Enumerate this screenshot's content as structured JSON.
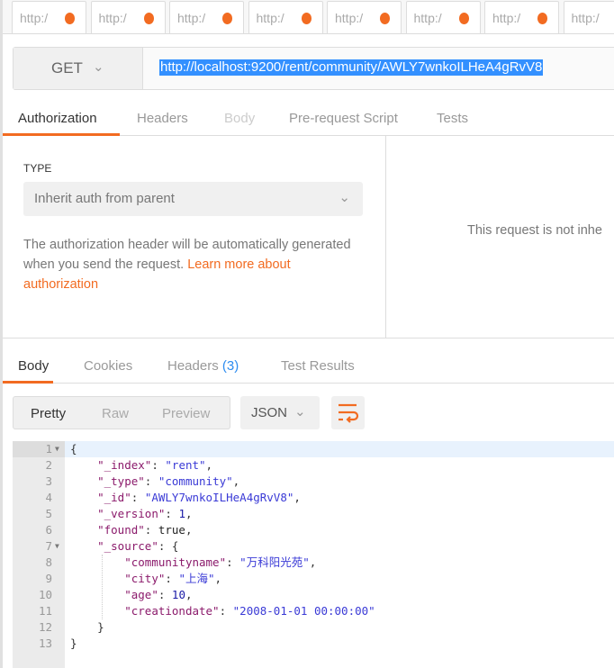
{
  "request_tabs": [
    {
      "label": "http:/"
    },
    {
      "label": "http:/"
    },
    {
      "label": "http:/"
    },
    {
      "label": "http:/"
    },
    {
      "label": "http:/"
    },
    {
      "label": "http:/"
    },
    {
      "label": "http:/"
    },
    {
      "label": "http:/"
    }
  ],
  "request": {
    "method": "GET",
    "url": "http://localhost:9200/rent/community/AWLY7wnkoILHeA4gRvV8"
  },
  "request_subtabs": {
    "authorization": "Authorization",
    "headers": "Headers",
    "body": "Body",
    "prerequest": "Pre-request Script",
    "tests": "Tests"
  },
  "auth": {
    "type_label": "TYPE",
    "type_value": "Inherit auth from parent",
    "description": "The authorization header will be automatically generated when you send the request. ",
    "learn_more": "Learn more about authorization",
    "right_message": "This request is not inhe"
  },
  "response_tabs": {
    "body": "Body",
    "cookies": "Cookies",
    "headers": "Headers",
    "headers_count": "(3)",
    "test_results": "Test Results"
  },
  "view_modes": {
    "pretty": "Pretty",
    "raw": "Raw",
    "preview": "Preview"
  },
  "format": "JSON",
  "icons": {
    "dropdown": "chevron-down-icon",
    "wrap": "wrap-lines-icon",
    "unsaved": "unsaved-dot-icon"
  },
  "colors": {
    "accent": "#f26b21",
    "selection": "#3390ff",
    "count": "#2d8cf0"
  },
  "response_lines": [
    {
      "n": "1",
      "fold": true,
      "t": [
        [
          "p",
          "{"
        ]
      ]
    },
    {
      "n": "2",
      "t": [
        [
          "p",
          "    "
        ],
        [
          "k",
          "\"_index\""
        ],
        [
          "p",
          ": "
        ],
        [
          "s",
          "\"rent\""
        ],
        [
          "p",
          ","
        ]
      ]
    },
    {
      "n": "3",
      "t": [
        [
          "p",
          "    "
        ],
        [
          "k",
          "\"_type\""
        ],
        [
          "p",
          ": "
        ],
        [
          "s",
          "\"community\""
        ],
        [
          "p",
          ","
        ]
      ]
    },
    {
      "n": "4",
      "t": [
        [
          "p",
          "    "
        ],
        [
          "k",
          "\"_id\""
        ],
        [
          "p",
          ": "
        ],
        [
          "s",
          "\"AWLY7wnkoILHeA4gRvV8\""
        ],
        [
          "p",
          ","
        ]
      ]
    },
    {
      "n": "5",
      "t": [
        [
          "p",
          "    "
        ],
        [
          "k",
          "\"_version\""
        ],
        [
          "p",
          ": "
        ],
        [
          "n",
          "1"
        ],
        [
          "p",
          ","
        ]
      ]
    },
    {
      "n": "6",
      "t": [
        [
          "p",
          "    "
        ],
        [
          "k",
          "\"found\""
        ],
        [
          "p",
          ": "
        ],
        [
          "b",
          "true"
        ],
        [
          "p",
          ","
        ]
      ]
    },
    {
      "n": "7",
      "fold": true,
      "t": [
        [
          "p",
          "    "
        ],
        [
          "k",
          "\"_source\""
        ],
        [
          "p",
          ": {"
        ]
      ]
    },
    {
      "n": "8",
      "t": [
        [
          "p",
          "        "
        ],
        [
          "k",
          "\"communityname\""
        ],
        [
          "p",
          ": "
        ],
        [
          "s",
          "\"万科阳光苑\""
        ],
        [
          "p",
          ","
        ]
      ]
    },
    {
      "n": "9",
      "t": [
        [
          "p",
          "        "
        ],
        [
          "k",
          "\"city\""
        ],
        [
          "p",
          ": "
        ],
        [
          "s",
          "\"上海\""
        ],
        [
          "p",
          ","
        ]
      ]
    },
    {
      "n": "10",
      "t": [
        [
          "p",
          "        "
        ],
        [
          "k",
          "\"age\""
        ],
        [
          "p",
          ": "
        ],
        [
          "n",
          "10"
        ],
        [
          "p",
          ","
        ]
      ]
    },
    {
      "n": "11",
      "t": [
        [
          "p",
          "        "
        ],
        [
          "k",
          "\"creationdate\""
        ],
        [
          "p",
          ": "
        ],
        [
          "s",
          "\"2008-01-01 00:00:00\""
        ]
      ]
    },
    {
      "n": "12",
      "t": [
        [
          "p",
          "    }"
        ]
      ]
    },
    {
      "n": "13",
      "t": [
        [
          "p",
          "}"
        ]
      ]
    }
  ]
}
